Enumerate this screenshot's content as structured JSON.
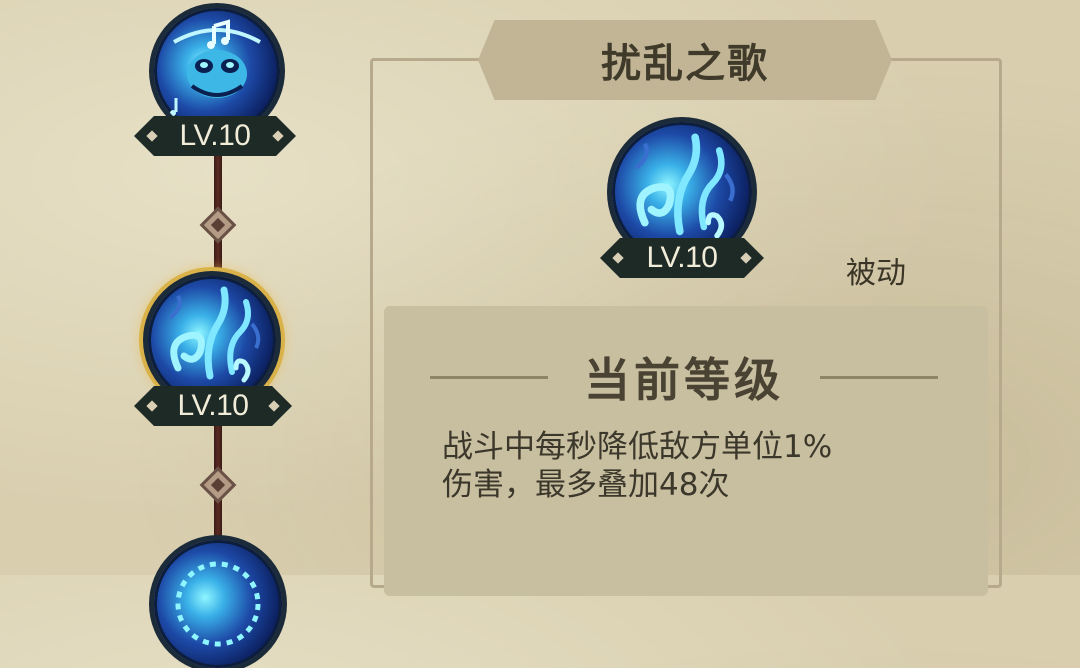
{
  "colors": {
    "parchment": "#d9cfaf",
    "orb_blue": "#1d4aa7",
    "selected_ring": "#d9b24a",
    "badge_bg": "#1e2a26",
    "tree_line": "#5a2a22"
  },
  "skill_tree": {
    "nodes": [
      {
        "icon": "frog-music-icon",
        "level": "LV.10",
        "selected": false
      },
      {
        "icon": "water-swirl-icon",
        "level": "LV.10",
        "selected": true
      },
      {
        "icon": "spiky-orb-icon",
        "level": "",
        "selected": false
      }
    ]
  },
  "detail": {
    "title": "扰乱之歌",
    "skill_icon": "water-swirl-icon",
    "skill_level": "LV.10",
    "type": "被动",
    "section_title": "当前等级",
    "description_lines": [
      "战斗中每秒降低敌方单位1%",
      "伤害，最多叠加48次"
    ]
  }
}
